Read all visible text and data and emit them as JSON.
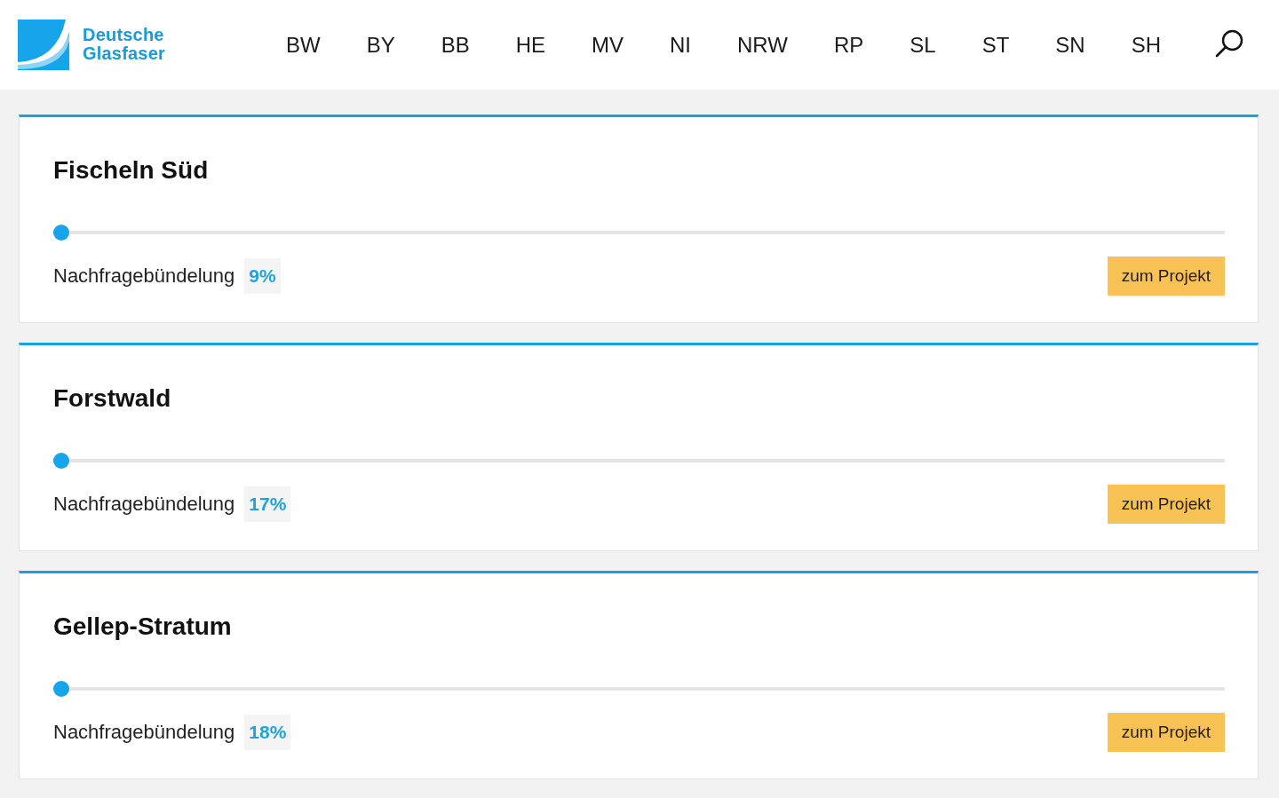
{
  "header": {
    "logo": {
      "lines": [
        "Deutsche",
        "Glasfaser"
      ]
    },
    "nav": [
      {
        "label": "BW"
      },
      {
        "label": "BY"
      },
      {
        "label": "BB"
      },
      {
        "label": "HE"
      },
      {
        "label": "MV"
      },
      {
        "label": "NI"
      },
      {
        "label": "NRW"
      },
      {
        "label": "RP"
      },
      {
        "label": "SL"
      },
      {
        "label": "ST"
      },
      {
        "label": "SN"
      },
      {
        "label": "SH"
      }
    ]
  },
  "projects": [
    {
      "title": "Fischeln Süd",
      "progress": {
        "level": 0
      },
      "label": "Nachfragebündelung",
      "percent": "9%",
      "button": "zum Projekt"
    },
    {
      "title": "Forstwald",
      "progress": {
        "level": 0
      },
      "label": "Nachfragebündelung",
      "percent": "17%",
      "button": "zum Projekt"
    },
    {
      "title": "Gellep-Stratum",
      "progress": {
        "level": 0
      },
      "label": "Nachfragebündelung",
      "percent": "18%",
      "button": "zum Projekt"
    }
  ]
}
